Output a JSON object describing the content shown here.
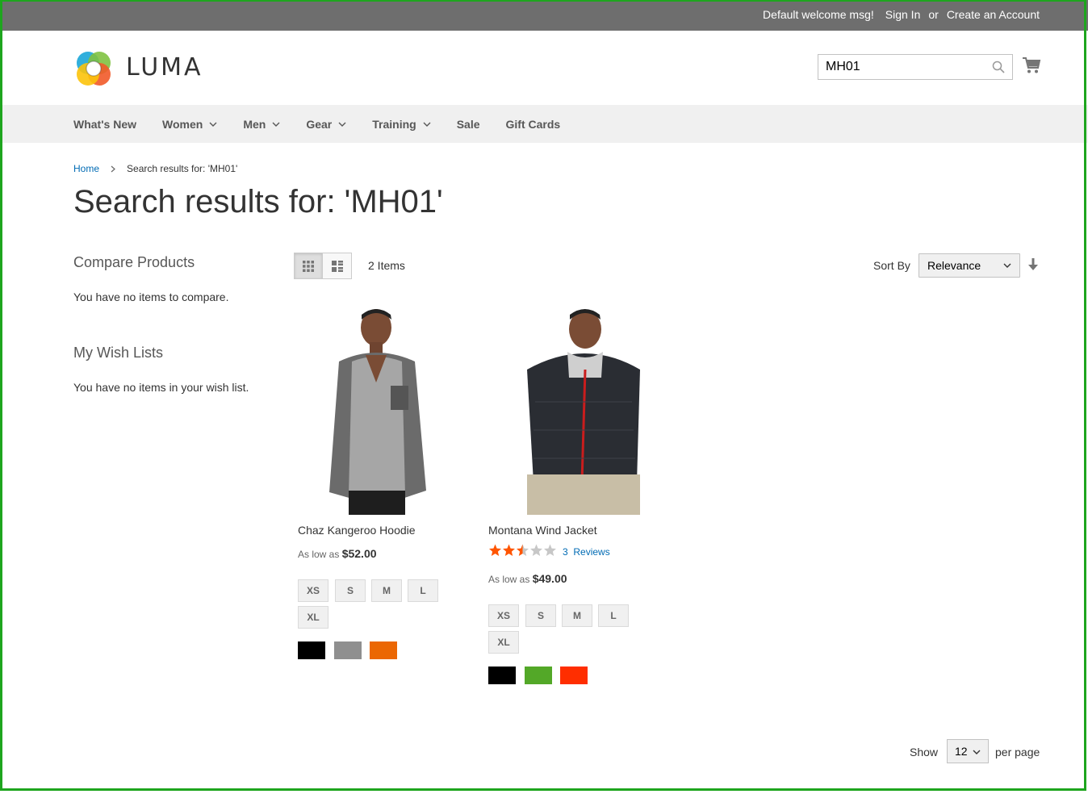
{
  "topbar": {
    "welcome": "Default welcome msg!",
    "sign_in": "Sign In",
    "or": "or",
    "create_account": "Create an Account"
  },
  "header": {
    "logo_text": "LUMA",
    "search_value": "MH01"
  },
  "nav": {
    "items": [
      {
        "label": "What's New",
        "dropdown": false
      },
      {
        "label": "Women",
        "dropdown": true
      },
      {
        "label": "Men",
        "dropdown": true
      },
      {
        "label": "Gear",
        "dropdown": true
      },
      {
        "label": "Training",
        "dropdown": true
      },
      {
        "label": "Sale",
        "dropdown": false
      },
      {
        "label": "Gift Cards",
        "dropdown": false
      }
    ]
  },
  "breadcrumb": {
    "home": "Home",
    "separator": ">",
    "current": "Search results for: 'MH01'"
  },
  "page_title": "Search results for: 'MH01'",
  "sidebar": {
    "compare_title": "Compare Products",
    "compare_text": "You have no items to compare.",
    "wishlist_title": "My Wish Lists",
    "wishlist_text": "You have no items in your wish list."
  },
  "toolbar": {
    "items_count": "2 Items",
    "sort_label": "Sort By",
    "sort_value": "Relevance",
    "show_label": "Show",
    "limit_value": "12",
    "per_page": "per page"
  },
  "products": [
    {
      "name": "Chaz Kangeroo Hoodie",
      "price_prefix": "As low as",
      "price": "$52.00",
      "sizes": [
        "XS",
        "S",
        "M",
        "L",
        "XL"
      ],
      "colors": [
        "#000000",
        "#8f8f8f",
        "#eb6703"
      ]
    },
    {
      "name": "Montana Wind Jacket",
      "rating": 2.5,
      "reviews_count": "3",
      "reviews_label": "Reviews",
      "price_prefix": "As low as",
      "price": "$49.00",
      "sizes": [
        "XS",
        "S",
        "M",
        "L",
        "XL"
      ],
      "colors": [
        "#000000",
        "#53a828",
        "#ff2e00"
      ]
    }
  ],
  "colors": {
    "topbar": "#6e6e6e",
    "link": "#006bb4",
    "nav_bg": "#f0f0f0",
    "star": "#ff5501"
  }
}
